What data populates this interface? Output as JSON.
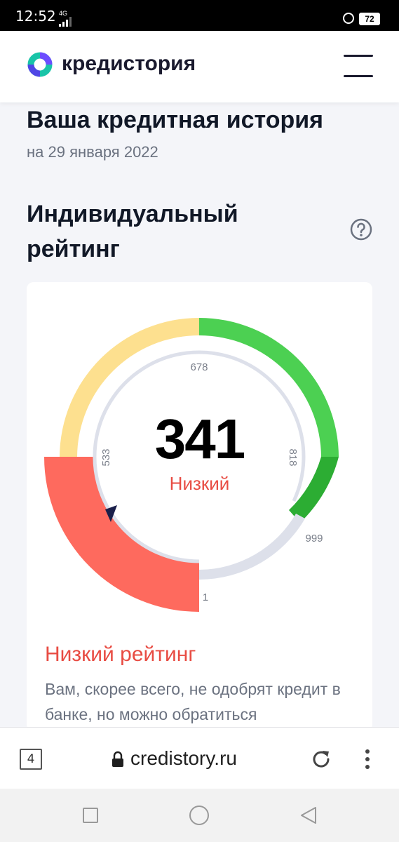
{
  "status_bar": {
    "time": "12:52",
    "network": "4G",
    "battery": "72"
  },
  "header": {
    "logo_text": "кредистория",
    "menu_icon": "hamburger-icon"
  },
  "page": {
    "title": "Ваша кредитная история",
    "date": "на 29 января 2022",
    "rating_title": "Индивидуальный рейтинг",
    "help_icon": "question-circle-icon"
  },
  "gauge": {
    "score": "341",
    "score_label": "Низкий",
    "ticks": {
      "t1": "1",
      "t533": "533",
      "t678": "678",
      "t818": "818",
      "t999": "999"
    },
    "min": 1,
    "max": 999,
    "value": 341,
    "colors": {
      "low": "#fe6a5e",
      "medium": "#fde08f",
      "good": "#4cd052",
      "excellent": "#2cad33",
      "track": "#dde0ea",
      "pointer": "#1a1f4a",
      "accent": "#e84c43"
    }
  },
  "description": {
    "title": "Низкий рейтинг",
    "text": "Вам, скорее всего, не одобрят кредит в банке, но можно обратиться"
  },
  "browser": {
    "tab_count": "4",
    "url": "credistory.ru"
  }
}
